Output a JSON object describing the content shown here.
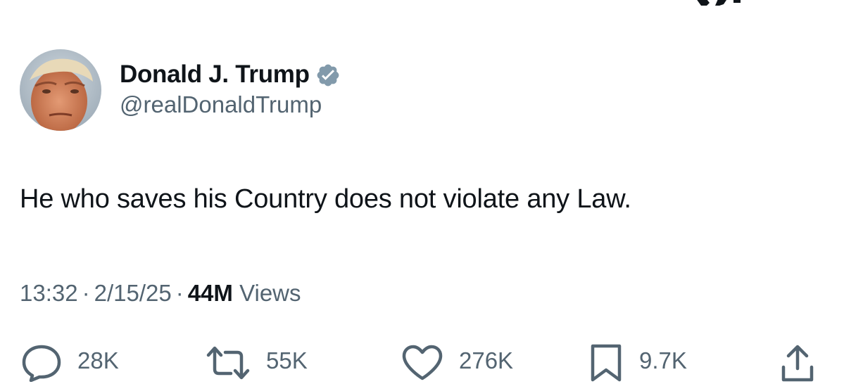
{
  "user": {
    "display_name": "Donald J. Trump",
    "handle": "@realDonaldTrump",
    "verified_icon": "verified-badge-icon",
    "verified_color": "#829aab"
  },
  "tweet": {
    "text": "He who saves his Country does not violate any Law."
  },
  "meta": {
    "time": "13:32",
    "separator": "·",
    "date": "2/15/25",
    "views_count": "44M",
    "views_label": "Views"
  },
  "actions": {
    "replies": "28K",
    "reposts": "55K",
    "likes": "276K",
    "bookmarks": "9.7K"
  },
  "colors": {
    "text_primary": "#0f1419",
    "text_secondary": "#536471",
    "icon": "#536471"
  }
}
